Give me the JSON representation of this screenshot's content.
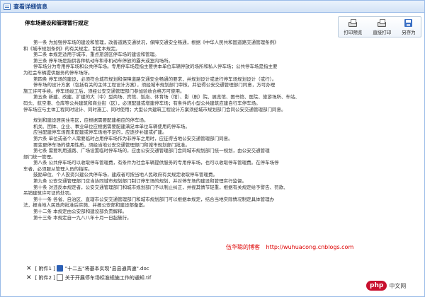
{
  "window": {
    "title": "查看详细信息"
  },
  "toolbar": {
    "buttons": [
      {
        "label": "打印预览",
        "icon": "printer-icon"
      },
      {
        "label": "直接打印",
        "icon": "printer-icon"
      },
      {
        "label": "另存为",
        "icon": "save-as-icon"
      }
    ]
  },
  "document": {
    "title": "停车场建设和管理暂行规定",
    "paragraphs": [
      "第一条 为加强停车场的建设和管理，改善道路交通状况，保障交通安全畅通，根据《中华人民共和国道路交通管理条例》",
      "和《城市规划条例》的有关规定，制定本规定。",
      "第二条 本规定适用于城市、重点旅游区停车场的建设和管理。",
      "第三条 停车场是指供各种机动车和非机动车停放的露天或室内场所。",
      "停车场分为专用停车场和公共停车场。专用停车场是指主要供本单位车辆停放的场所和私人停车场；公共停车场是指主要",
      "为社会车辆提供服务的停车场所。",
      "第四条 停车场的建设，必须符合城市规划和保障道路交通安全畅通的要求，并规划设计或进行停车场规划设计（或行）。",
      "停车场的设计方案（包括有关的主体工程设计方案），须经城市规划部门审核，并征得公安交通管理部门同意，方可办理",
      "施工许可手续。停车场竣工后，须经公安交通管理部门参加验收合格方可使用。",
      "第五条 新建、改建、扩建的大（中）型商场、宾馆、饭店、体育场（馆）、影（剧）院、展览馆、图书馆、医院、旅游场所、车站、",
      "码头、航空港、仓库等公共建筑和商业街（区），必须配建或增建停车场；有条件的小型公共建筑应建自行车停车场。",
      "停车场应与主体工程同时设计、同时施工、同时使用；大型公共建筑工程设计方案须经城市规划部门会同公安交通管理部门同意。",
      "规划和建设居民住宅区，应根据需要配建相应的停车场。",
      "机关、团体、企业、事业单位应根据需要配建满足本单位车辆使用的停车场。",
      "应当配建停车场而未配建或停车场地不足的，应逐步补建或扩建。",
      "第六条 单位或者个人需要临时占用停车场作为非停车之用时，应征得当地公安交通管理部门同意。",
      "要变更停车场的使用性质，须经当地公安交通管理部门和城市规划部门批准。",
      "第七条 需要利用道路、广场设置临时停车场的，应由公安交通管理部门会同城市规划部门统一规划，由公安交通管理",
      "部门统一管理。",
      "第八条 公共停车场可以收取停车管理费，有条件为社会车辆提供服务的专用停车场，也可以收取停车管理费。在停车场停",
      "车者，必须服从管理人员的指挥。",
      "鼓励单位、个人投资兴建公共停车场，建成者可按当地人民政府有关规定收取停车管理费。",
      "第九条 公安交通管理部门应当协同城市规划部门制订停车场的规划，并对停车场的建设和管理实行监督。",
      "第十条 对违反本规定者，公安交通管理部门和城市规划部门予以制止纠正，并视其情节轻重，根据有关规定给予警告、罚款、",
      "吊销建筑许可证的处罚。",
      "第十一条 各省、自治区、直辖市公安交通管理部门和城市规划部门可以根据本规定，结合当地实际情况制定具体管理办",
      "法，报当地人民政府批准后实施，并报公安部和建设部备案。",
      "第十二条 本规定由公安部和建设部负责解释。",
      "第十三条 本规定自一九八八年十月一日起施行。"
    ]
  },
  "watermark": {
    "name": "伍华聪的博客",
    "url": "http://wuhuacong.cnblogs.com"
  },
  "attachments": [
    {
      "label": "[ 附件1 ]",
      "icon": "word-doc-icon",
      "name": "\"十二五\"将基本实现\"县县通高速\".doc"
    },
    {
      "label": "[ 附件2 ]",
      "icon": "file-icon",
      "name": "关于开展停车场标准规施工作的通知.tif"
    }
  ],
  "badge": {
    "logo": "php",
    "text": "中文网"
  }
}
